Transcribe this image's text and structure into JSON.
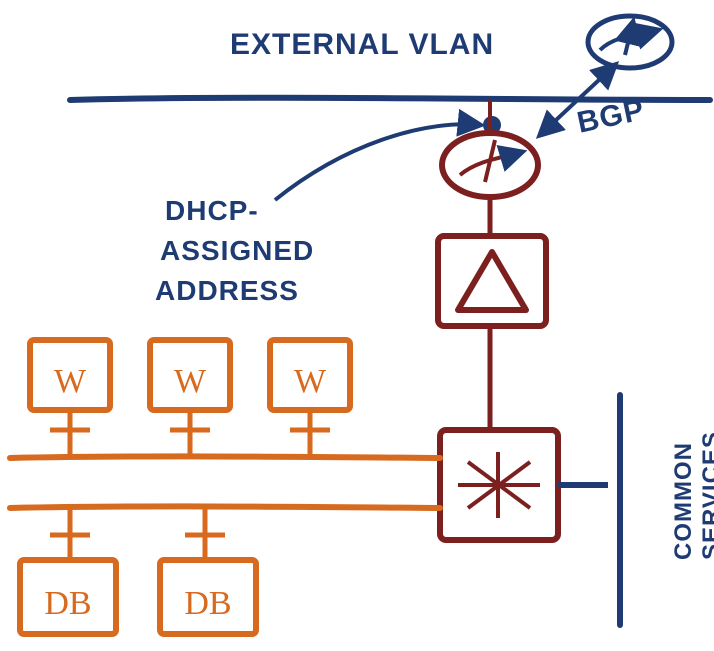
{
  "labels": {
    "external_vlan": "EXTERNAL VLAN",
    "bgp": "BGP",
    "dhcp_line1": "DHCP-",
    "dhcp_line2": "ASSIGNED",
    "dhcp_line3": "ADDRESS",
    "common_services_line1": "COMMON",
    "common_services_line2": "SERVICES"
  },
  "nodes": {
    "external_router": "external-router",
    "tenant_router": "tenant-router",
    "firewall": "firewall",
    "switch": "switch",
    "web1": "W",
    "web2": "W",
    "web3": "W",
    "db1": "DB",
    "db2": "DB"
  },
  "colors": {
    "blue": "#1f3b73",
    "maroon": "#7c1f1f",
    "orange": "#d76a1e"
  }
}
